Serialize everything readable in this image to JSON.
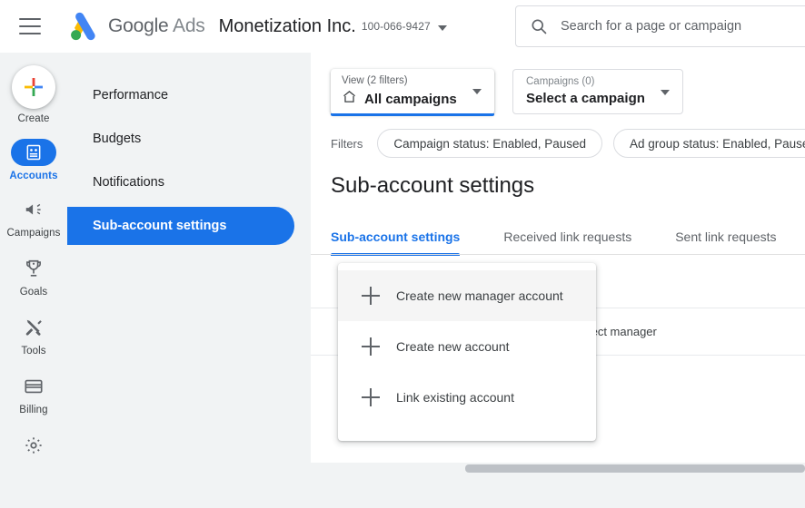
{
  "header": {
    "menu_icon": "hamburger-menu-icon",
    "logo_icon": "google-ads-logo-icon",
    "brand_google": "Google",
    "brand_ads": "Ads",
    "account_name": "Monetization Inc.",
    "account_id": "100-066-9427",
    "account_caret_icon": "chevron-down-icon"
  },
  "search": {
    "icon": "search-icon",
    "placeholder": "Search for a page or campaign"
  },
  "rail": {
    "items": [
      {
        "label": "Create",
        "icon": "plus-colored-icon",
        "active": false
      },
      {
        "label": "Accounts",
        "icon": "accounts-icon",
        "active": true
      },
      {
        "label": "Campaigns",
        "icon": "megaphone-icon",
        "active": false
      },
      {
        "label": "Goals",
        "icon": "trophy-icon",
        "active": false
      },
      {
        "label": "Tools",
        "icon": "tools-icon",
        "active": false
      },
      {
        "label": "Billing",
        "icon": "credit-card-icon",
        "active": false
      },
      {
        "label": "",
        "icon": "gear-icon",
        "active": false
      }
    ]
  },
  "subnav": {
    "items": [
      {
        "label": "Performance",
        "active": false
      },
      {
        "label": "Budgets",
        "active": false
      },
      {
        "label": "Notifications",
        "active": false
      },
      {
        "label": "Sub-account settings",
        "active": true
      }
    ]
  },
  "view_select": {
    "label": "View (2 filters)",
    "value": "All campaigns",
    "icon": "home-icon",
    "caret_icon": "chevron-down-icon"
  },
  "campaign_select": {
    "label": "Campaigns (0)",
    "value": "Select a campaign",
    "caret_icon": "chevron-down-icon"
  },
  "filters": {
    "label": "Filters",
    "chips": [
      "Campaign status: Enabled, Paused",
      "Ad group status: Enabled, Paused"
    ]
  },
  "page": {
    "title": "Sub-account settings"
  },
  "tabs": [
    {
      "label": "Sub-account settings",
      "active": true
    },
    {
      "label": "Received link requests",
      "active": false
    },
    {
      "label": "Sent link requests",
      "active": false
    }
  ],
  "table": {
    "rows": [
      {
        "text": ""
      },
      {
        "text": "Direct manager"
      },
      {
        "text": ""
      }
    ]
  },
  "menu": {
    "items": [
      {
        "label": "Create new manager account",
        "icon": "plus-icon",
        "hover": true
      },
      {
        "label": "Create new account",
        "icon": "plus-icon",
        "hover": false
      },
      {
        "label": "Link existing account",
        "icon": "plus-icon",
        "hover": false
      }
    ]
  },
  "colors": {
    "accent": "#1a73e8",
    "rail_bg": "#f1f3f4",
    "text_primary": "#202124",
    "text_secondary": "#5f6368",
    "logo_blue": "#4285f4",
    "logo_yellow": "#fbbc04",
    "logo_green": "#34a853"
  }
}
